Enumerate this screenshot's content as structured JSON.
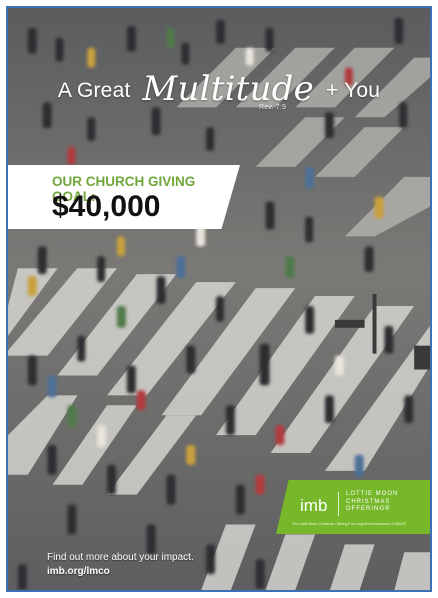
{
  "poster": {
    "title_prefix": "A Great",
    "title_script": "Multitude",
    "title_ref": "Rev. 7:9",
    "title_suffix": "+ You",
    "goal_label": "OUR CHURCH GIVING GOAL:",
    "goal_amount": "$40,000",
    "find_out": "Find out more about your impact.",
    "url": "imb.org/lmco"
  },
  "badge": {
    "logo": "imb",
    "offering": "LOTTIE MOON\nCHRISTMAS\nOFFERING®",
    "small_print": "The Lottie Moon Christmas Offering® is a registered trademark of WMU®"
  },
  "colors": {
    "frame": "#3d6fb5",
    "accent_green": "#76b82a",
    "goal_label_green": "#70a63a"
  }
}
